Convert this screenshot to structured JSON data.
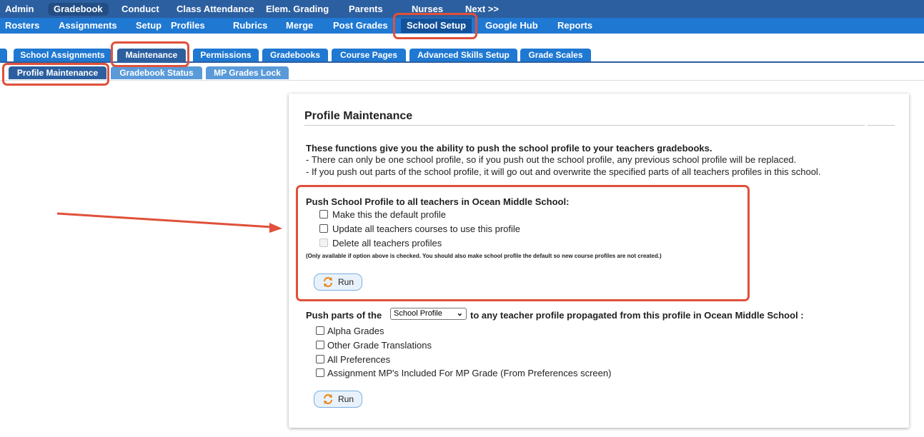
{
  "top_nav": [
    {
      "label": "Admin",
      "selected": false
    },
    {
      "label": "Gradebook",
      "selected": true
    },
    {
      "label": "Conduct",
      "selected": false
    },
    {
      "label": "Class Attendance",
      "selected": false
    },
    {
      "label": "Elem. Grading",
      "selected": false
    },
    {
      "label": "Parents",
      "selected": false
    },
    {
      "label": "Nurses",
      "selected": false
    },
    {
      "label": "Next >>",
      "selected": false
    }
  ],
  "sub_nav": [
    {
      "label": "Rosters",
      "selected": false
    },
    {
      "label": "Assignments",
      "selected": false
    },
    {
      "label": "Setup",
      "selected": false
    },
    {
      "label": "Profiles",
      "selected": false
    },
    {
      "label": "Rubrics",
      "selected": false
    },
    {
      "label": "Merge",
      "selected": false
    },
    {
      "label": "Post Grades",
      "selected": false
    },
    {
      "label": "School Setup",
      "selected": true
    },
    {
      "label": "Google Hub",
      "selected": false
    },
    {
      "label": "Reports",
      "selected": false
    }
  ],
  "tabs": [
    {
      "label": "School Assignments",
      "selected": false
    },
    {
      "label": "Maintenance",
      "selected": true
    },
    {
      "label": "Permissions",
      "selected": false
    },
    {
      "label": "Gradebooks",
      "selected": false
    },
    {
      "label": "Course Pages",
      "selected": false
    },
    {
      "label": "Advanced Skills Setup",
      "selected": false
    },
    {
      "label": "Grade Scales",
      "selected": false
    }
  ],
  "subtabs": [
    {
      "label": "Profile Maintenance",
      "selected": true
    },
    {
      "label": "Gradebook Status",
      "selected": false
    },
    {
      "label": "MP Grades Lock",
      "selected": false
    }
  ],
  "panel": {
    "title": "Profile Maintenance",
    "intro_bold": "These functions give you the ability to push the school profile to your teachers gradebooks.",
    "intro_line1": "- There can only be one school profile, so if you push out the school profile, any previous school profile will be replaced.",
    "intro_line2": "- If you push out parts of the school profile, it will go out and overwrite the specified parts of all teachers profiles in this school.",
    "push_heading": "Push School Profile to all teachers in Ocean Middle School:",
    "push_options": [
      {
        "label": "Make this the default profile",
        "checked": false,
        "disabled": false
      },
      {
        "label": "Update all teachers courses to use this profile",
        "checked": false,
        "disabled": false
      },
      {
        "label": "Delete all teachers profiles",
        "checked": false,
        "disabled": true
      }
    ],
    "push_note": "(Only available if option above is checked. You should also make school profile the default so new course profiles are not created.)",
    "run_label": "Run",
    "parts_prefix": "Push parts of the",
    "parts_select_value": "School Profile",
    "parts_suffix": "to any teacher profile propagated from this profile in Ocean Middle School :",
    "parts_options": [
      {
        "label": "Alpha Grades",
        "checked": false
      },
      {
        "label": "Other Grade Translations",
        "checked": false
      },
      {
        "label": "All Preferences",
        "checked": false
      },
      {
        "label": "Assignment MP's Included For MP Grade (From Preferences screen)",
        "checked": false
      }
    ],
    "run2_label": "Run"
  },
  "colors": {
    "nav_dark": "#2c5fa0",
    "nav_blue": "#1f78d1",
    "highlight": "#e0503a",
    "arrow": "#e0503a"
  }
}
